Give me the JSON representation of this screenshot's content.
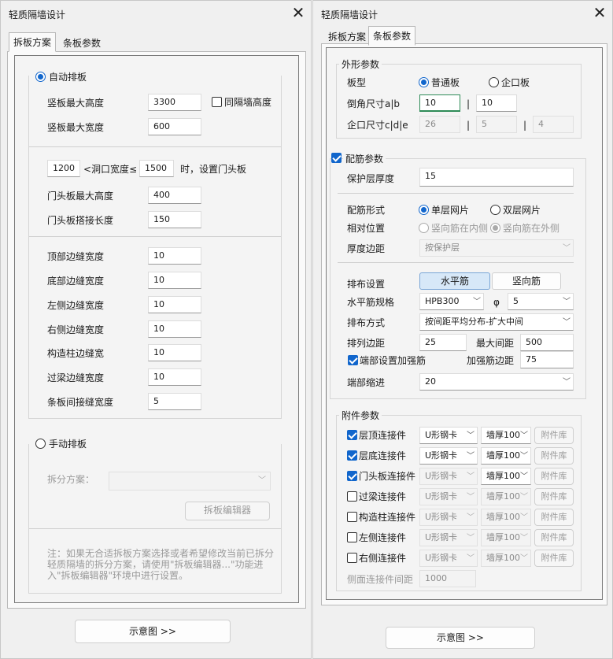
{
  "left": {
    "title": "轻质隔墙设计",
    "tabs": [
      "拆板方案",
      "条板参数"
    ],
    "auto": {
      "label": "自动排板",
      "max_height_label": "竖板最大高度",
      "max_height": "3300",
      "same_height_label": "同隔墙高度",
      "max_width_label": "竖板最大宽度",
      "max_width": "600",
      "opening_min": "1200",
      "opening_mid": "<洞口宽度≤",
      "opening_max": "1500",
      "opening_suffix": "时，设置门头板",
      "header_height_label": "门头板最大高度",
      "header_height": "400",
      "header_overlap_label": "门头板搭接长度",
      "header_overlap": "150",
      "gaps": [
        {
          "label": "顶部边缝宽度",
          "value": "10"
        },
        {
          "label": "底部边缝宽度",
          "value": "10"
        },
        {
          "label": "左侧边缝宽度",
          "value": "10"
        },
        {
          "label": "右侧边缝宽度",
          "value": "10"
        },
        {
          "label": "构造柱边缝宽",
          "value": "10"
        },
        {
          "label": "过梁边缝宽度",
          "value": "10"
        },
        {
          "label": "条板间接缝宽度",
          "value": "5"
        }
      ]
    },
    "manual": {
      "label": "手动排板",
      "scheme_label": "拆分方案：",
      "editor_button": "拆板编辑器",
      "note": "注：如果无合适拆板方案选择或者希望修改当前已拆分轻质隔墙的拆分方案，请使用\"拆板编辑器...\"功能进入\"拆板编辑器\"环境中进行设置。"
    },
    "diagram_button": "示意图 >>"
  },
  "right": {
    "title": "轻质隔墙设计",
    "tabs": [
      "拆板方案",
      "条板参数"
    ],
    "shape": {
      "title": "外形参数",
      "type_label": "板型",
      "type_opt1": "普通板",
      "type_opt2": "企口板",
      "chamfer_label": "倒角尺寸a|b",
      "chamfer_a": "10",
      "sep": "|",
      "chamfer_b": "10",
      "tongue_label": "企口尺寸c|d|e",
      "tongue_c": "26",
      "tongue_d": "5",
      "tongue_e": "4"
    },
    "rebar": {
      "title": "配筋参数",
      "cover_label": "保护层厚度",
      "cover": "15",
      "form_label": "配筋形式",
      "form_opt1": "单层网片",
      "form_opt2": "双层网片",
      "pos_label": "相对位置",
      "pos_opt1": "竖向筋在内侧",
      "pos_opt2": "竖向筋在外侧",
      "edge_label": "厚度边距",
      "edge_value": "按保护层",
      "layout_label": "排布设置",
      "seg_h": "水平筋",
      "seg_v": "竖向筋",
      "spec_label": "水平筋规格",
      "spec_value": "HPB300",
      "phi": "φ",
      "phi_value": "5",
      "method_label": "排布方式",
      "method_value": "按间距平均分布-扩大中间",
      "margin_label": "排列边距",
      "margin": "25",
      "maxgap_label": "最大间距",
      "maxgap": "500",
      "end_reinf_label": "端部设置加强筋",
      "reinf_margin_label": "加强筋边距",
      "reinf_margin": "75",
      "end_indent_label": "端部缩进",
      "end_indent": "20"
    },
    "acc": {
      "title": "附件参数",
      "items": [
        {
          "label": "层顶连接件",
          "type": "U形钢卡",
          "wall": "墙厚100",
          "lib": "附件库"
        },
        {
          "label": "层底连接件",
          "type": "U形钢卡",
          "wall": "墙厚100",
          "lib": "附件库"
        },
        {
          "label": "门头板连接件",
          "type": "U形钢卡",
          "wall": "墙厚100",
          "lib": "附件库"
        },
        {
          "label": "过梁连接件",
          "type": "U形钢卡",
          "wall": "墙厚100",
          "lib": "附件库"
        },
        {
          "label": "构造柱连接件",
          "type": "U形钢卡",
          "wall": "墙厚100",
          "lib": "附件库"
        },
        {
          "label": "左侧连接件",
          "type": "U形钢卡",
          "wall": "墙厚100",
          "lib": "附件库"
        },
        {
          "label": "右侧连接件",
          "type": "U形钢卡",
          "wall": "墙厚100",
          "lib": "附件库"
        }
      ],
      "side_gap_label": "侧面连接件间距",
      "side_gap": "1000"
    },
    "diagram_button": "示意图 >>"
  }
}
